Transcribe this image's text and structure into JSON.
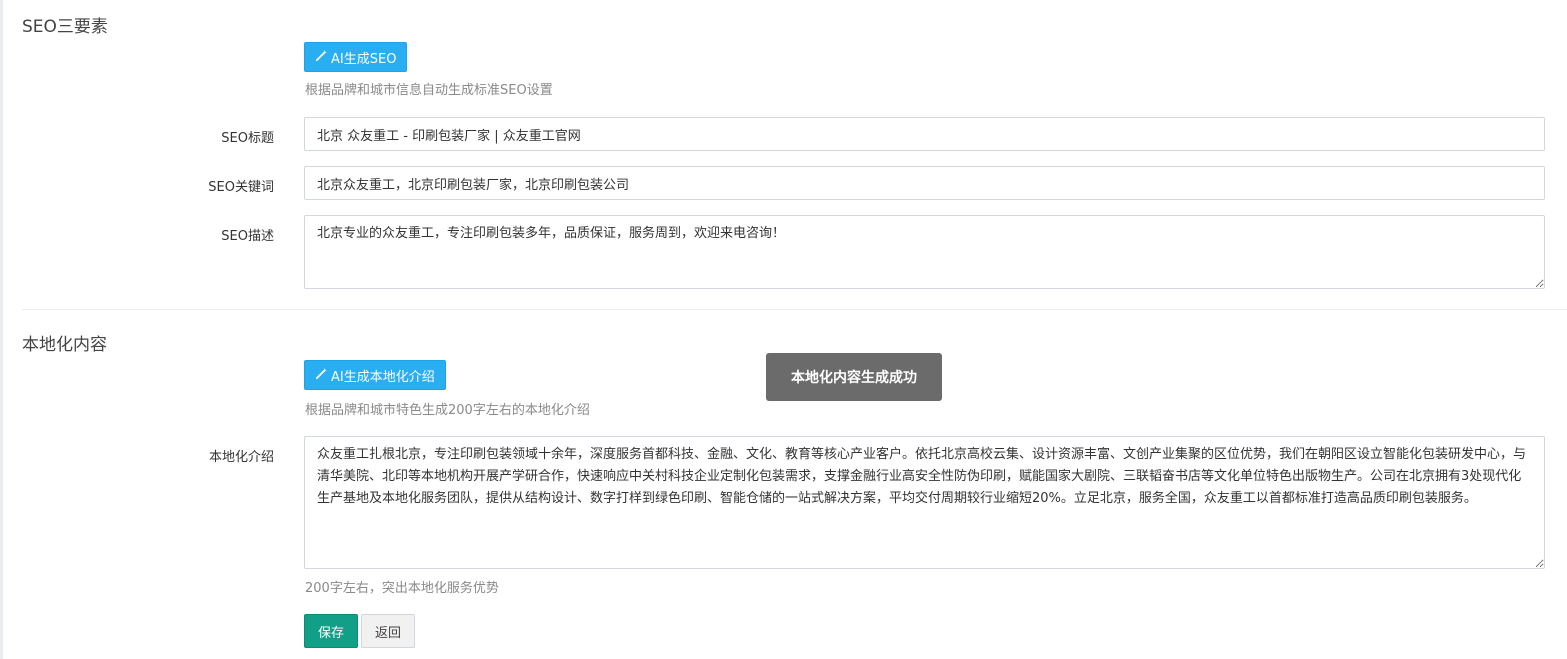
{
  "seo": {
    "section_title": "SEO三要素",
    "ai_button_label": "AI生成SEO",
    "ai_hint": "根据品牌和城市信息自动生成标准SEO设置",
    "title_label": "SEO标题",
    "title_value": "北京 众友重工 - 印刷包装厂家 | 众友重工官网",
    "keywords_label": "SEO关键词",
    "keywords_value": "北京众友重工，北京印刷包装厂家，北京印刷包装公司",
    "description_label": "SEO描述",
    "description_value": "北京专业的众友重工，专注印刷包装多年，品质保证，服务周到，欢迎来电咨询！"
  },
  "local": {
    "section_title": "本地化内容",
    "ai_button_label": "AI生成本地化介绍",
    "ai_hint": "根据品牌和城市特色生成200字左右的本地化介绍",
    "intro_label": "本地化介绍",
    "intro_value": "众友重工扎根北京，专注印刷包装领域十余年，深度服务首都科技、金融、文化、教育等核心产业客户。依托北京高校云集、设计资源丰富、文创产业集聚的区位优势，我们在朝阳区设立智能化包装研发中心，与清华美院、北印等本地机构开展产学研合作，快速响应中关村科技企业定制化包装需求，支撑金融行业高安全性防伪印刷，赋能国家大剧院、三联韬奋书店等文化单位特色出版物生产。公司在北京拥有3处现代化生产基地及本地化服务团队，提供从结构设计、数字打样到绿色印刷、智能仓储的一站式解决方案，平均交付周期较行业缩短20%。立足北京，服务全国，众友重工以首都标准打造高品质印刷包装服务。",
    "intro_hint": "200字左右，突出本地化服务优势"
  },
  "toast": {
    "message": "本地化内容生成成功"
  },
  "actions": {
    "save_label": "保存",
    "back_label": "返回"
  },
  "colors": {
    "ai_button": "#29aef2",
    "save_button": "#11a087",
    "toast_bg": "#6b6b6b"
  },
  "icons": {
    "ai_button_icon": "magic-wand-icon"
  }
}
